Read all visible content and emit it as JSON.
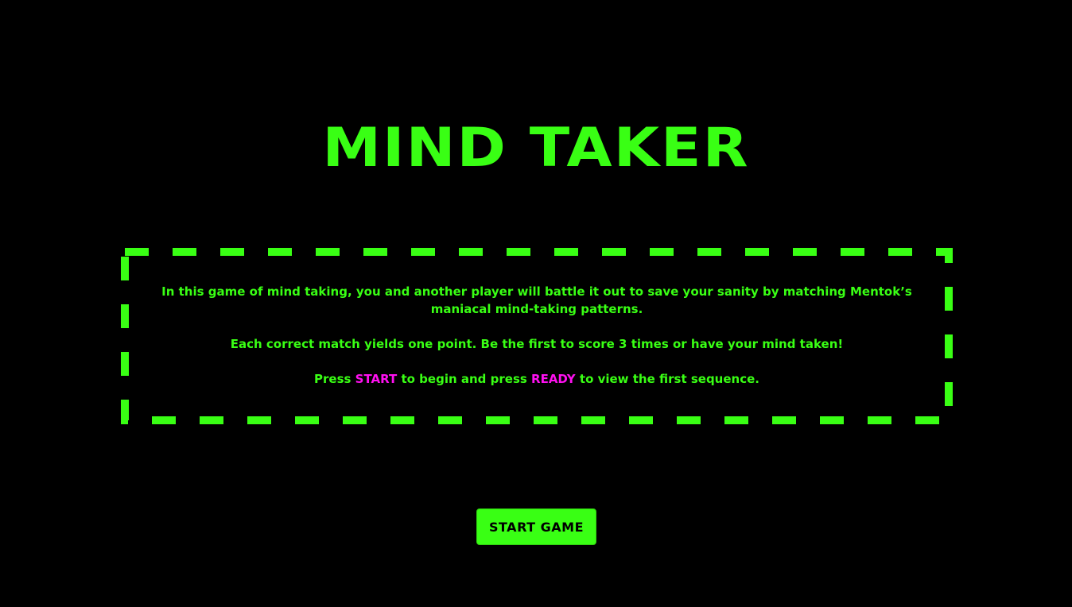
{
  "game": {
    "title": "MIND TAKER"
  },
  "instructions": {
    "paragraph1": "In this game of mind taking, you and another player will battle it out to save your sanity by matching Mentok’s maniacal mind-taking patterns.",
    "paragraph2": "Each correct match yields one point. Be the first to score 3 times or have your mind taken!",
    "paragraph3_prefix": "Press ",
    "paragraph3_start": "START",
    "paragraph3_middle": " to begin and press ",
    "paragraph3_ready": "READY",
    "paragraph3_suffix": " to view the first sequence."
  },
  "controls": {
    "start_button_label": "START GAME"
  },
  "colors": {
    "background": "#000000",
    "primary": "#39ff14",
    "highlight": "#ff10f0",
    "button_text": "#000000"
  }
}
